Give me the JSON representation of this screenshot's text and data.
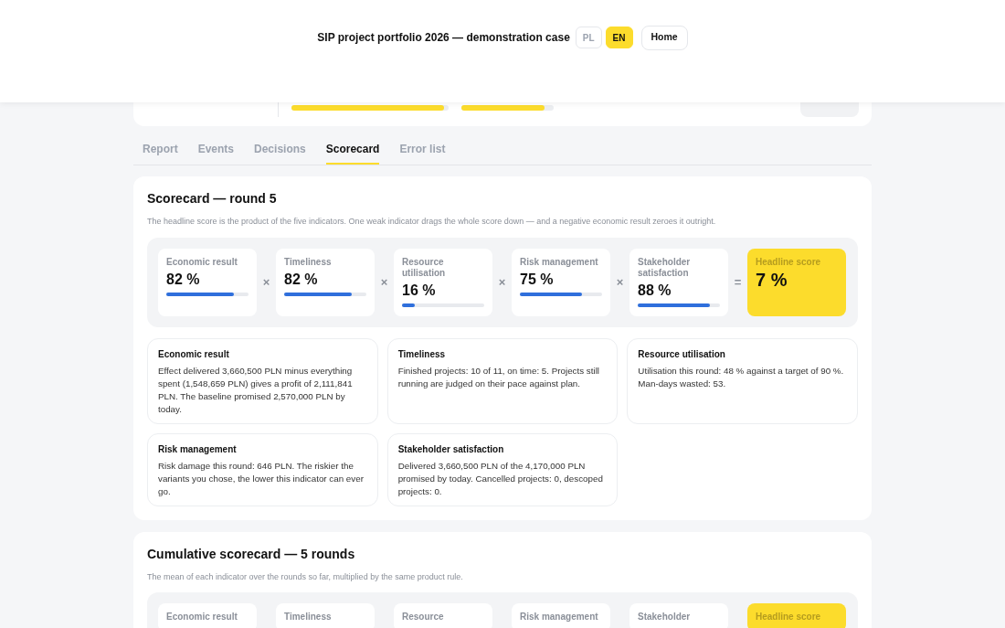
{
  "header": {
    "title": "SIP project portfolio 2026 — demonstration case",
    "languages": [
      {
        "label": "PL",
        "selected": false
      },
      {
        "label": "EN",
        "selected": true
      }
    ],
    "home_button": "Home"
  },
  "summary_card": {
    "bars": [
      {
        "level": 0.97
      },
      {
        "level": 0.9
      }
    ]
  },
  "tabs": [
    {
      "label": "Report",
      "selected": false
    },
    {
      "label": "Events",
      "selected": false
    },
    {
      "label": "Decisions",
      "selected": false
    },
    {
      "label": "Scorecard",
      "selected": true
    },
    {
      "label": "Error list",
      "selected": false
    }
  ],
  "scorecard": {
    "title": "Scorecard — round 5",
    "description": "The headline score is the product of the five indicators. One weak indicator drags the whole score down — and a negative economic result zeroes it outright.",
    "indicators": [
      {
        "kind": "indicator",
        "label": "Economic result",
        "value": "82 %",
        "level": 0.82,
        "operator": "×"
      },
      {
        "kind": "indicator",
        "label": "Timeliness",
        "value": "82 %",
        "level": 0.82,
        "operator": "×"
      },
      {
        "kind": "indicator",
        "label": "Resource utilisation",
        "value": "16 %",
        "level": 0.16,
        "operator": "×"
      },
      {
        "kind": "indicator",
        "label": "Risk management",
        "value": "75 %",
        "level": 0.75,
        "operator": "×"
      },
      {
        "kind": "indicator",
        "label": "Stakeholder satisfaction",
        "value": "88 %",
        "level": 0.88,
        "operator": "="
      },
      {
        "kind": "headline",
        "label": "Headline score",
        "value": "7 %"
      }
    ],
    "explanations": [
      {
        "title": "Economic result",
        "text": "Effect delivered 3,660,500 PLN minus everything spent (1,548,659 PLN) gives a profit of 2,111,841 PLN. The baseline promised 2,570,000 PLN by today."
      },
      {
        "title": "Timeliness",
        "text": "Finished projects: 10 of 11, on time: 5. Projects still running are judged on their pace against plan."
      },
      {
        "title": "Resource utilisation",
        "text": "Utilisation this round: 48 % against a target of 90 %. Man-days wasted: 53."
      },
      {
        "title": "Risk management",
        "text": "Risk damage this round: 646 PLN. The riskier the variants you chose, the lower this indicator can ever go."
      },
      {
        "title": "Stakeholder satisfaction",
        "text": "Delivered 3,660,500 PLN of the 4,170,000 PLN promised by today. Cancelled projects: 0, descoped projects: 0."
      }
    ]
  },
  "cumulative": {
    "title": "Cumulative scorecard — 5 rounds",
    "description": "The mean of each indicator over the rounds so far, multiplied by the same product rule.",
    "indicators": [
      {
        "kind": "indicator",
        "label": "Economic result"
      },
      {
        "kind": "indicator",
        "label": "Timeliness"
      },
      {
        "kind": "indicator",
        "label": "Resource"
      },
      {
        "kind": "indicator",
        "label": "Risk management"
      },
      {
        "kind": "indicator",
        "label": "Stakeholder"
      },
      {
        "kind": "headline",
        "label": "Headline score"
      }
    ]
  }
}
